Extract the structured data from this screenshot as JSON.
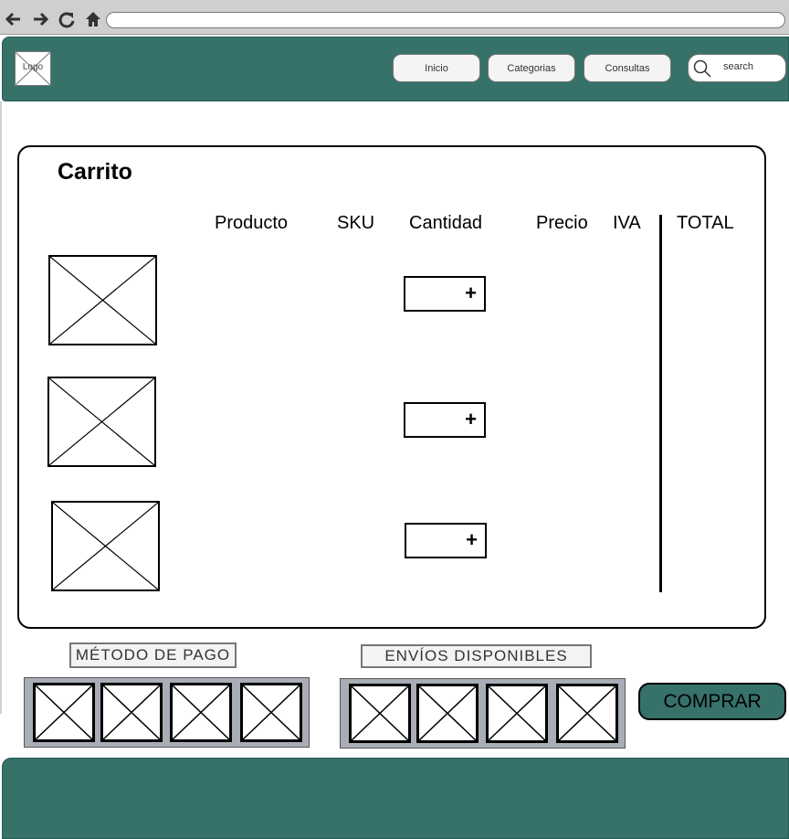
{
  "browser": {
    "icons": [
      "back-arrow-icon",
      "forward-arrow-icon",
      "reload-icon",
      "home-icon"
    ]
  },
  "header": {
    "logo_label": "Logo",
    "nav": [
      {
        "label": "Inicio"
      },
      {
        "label": "Categorias"
      },
      {
        "label": "Consultas"
      }
    ],
    "search_placeholder": "search",
    "color": "#36716a"
  },
  "cart": {
    "title": "Carrito",
    "columns": {
      "producto": "Producto",
      "sku": "SKU",
      "cantidad": "Cantidad",
      "precio": "Precio",
      "iva": "IVA",
      "total": "TOTAL"
    },
    "quantity_button_label": "+"
  },
  "payment": {
    "label": "MÉTODO DE PAGO"
  },
  "shipping": {
    "label": "ENVÍOS DISPONIBLES"
  },
  "buy_button_label": "COMPRAR",
  "colors": {
    "header": "#36716a",
    "footer": "#36716a",
    "buy_button": "#36716a",
    "tray": "#a9adb6"
  }
}
